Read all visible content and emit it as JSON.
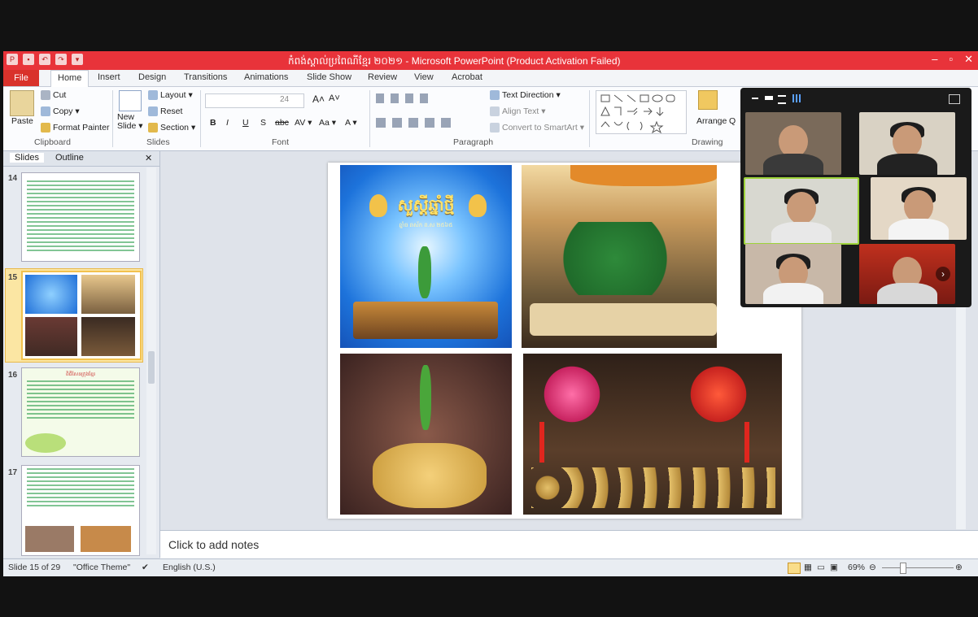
{
  "app": {
    "title": "កំពង់ស្គាល់ប្រពៃណីខ្មែរ ២០២១ - Microsoft PowerPoint (Product Activation Failed)",
    "window_controls": [
      "–",
      "▫",
      "✕"
    ]
  },
  "tabs": [
    "File",
    "Home",
    "Insert",
    "Design",
    "Transitions",
    "Animations",
    "Slide Show",
    "Review",
    "View",
    "Acrobat"
  ],
  "ribbon": {
    "clipboard": {
      "paste": "Paste",
      "cut": "Cut",
      "copy": "Copy ▾",
      "format_painter": "Format Painter",
      "group": "Clipboard"
    },
    "slides": {
      "new_slide": "New Slide ▾",
      "layout": "Layout ▾",
      "reset": "Reset",
      "section": "Section ▾",
      "group": "Slides"
    },
    "font": {
      "size": "24",
      "bold": "B",
      "italic": "I",
      "underline": "U",
      "strike": "S",
      "abc": "abc",
      "spacing": "AV ▾",
      "case": "Aa ▾",
      "color": "A ▾",
      "grow": "A˄",
      "shrink": "A˅",
      "group": "Font"
    },
    "paragraph": {
      "text_direction": "Text Direction ▾",
      "align_text": "Align Text ▾",
      "convert": "Convert to SmartArt ▾",
      "group": "Paragraph"
    },
    "drawing": {
      "arrange": "Arrange",
      "quick": "Q",
      "group": "Drawing"
    }
  },
  "panel": {
    "tabs": [
      "Slides",
      "Outline"
    ],
    "close": "✕",
    "thumbnails": [
      {
        "num": "14"
      },
      {
        "num": "15",
        "selected": true
      },
      {
        "num": "16",
        "heading": "ពិធីសែនក្រុងខ្មែរ"
      },
      {
        "num": "17"
      }
    ]
  },
  "slide": {
    "title_text": "សួស្តីឆ្នាំថ្មី",
    "subtitle_text": "ឆ្នាំច ឆស័ក ព.ស ២៥៦៥"
  },
  "notes": {
    "placeholder": "Click to add notes"
  },
  "status": {
    "slide_of": "Slide 15 of 29",
    "theme": "\"Office Theme\"",
    "language": "English (U.S.)",
    "zoom": "69%"
  },
  "colors": {
    "titlebar": "#e8333a",
    "file_tab": "#d9322b",
    "selection": "#fbe6a3"
  }
}
